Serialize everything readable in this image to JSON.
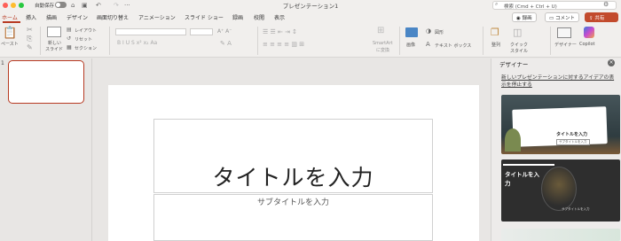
{
  "window": {
    "title": "プレゼンテーション1",
    "autosave_label": "自動保存",
    "search_placeholder": "検索 (Cmd + Ctrl + U)"
  },
  "tabs": [
    "ホーム",
    "挿入",
    "描画",
    "デザイン",
    "画面切り替え",
    "アニメーション",
    "スライド ショー",
    "録画",
    "校閲",
    "表示"
  ],
  "top_buttons": {
    "record": "録画",
    "comment": "コメント",
    "share": "共有"
  },
  "ribbon": {
    "paste": "ペースト",
    "new_slide_line1": "新しい",
    "new_slide_line2": "スライド",
    "layout": "レイアウト",
    "reset": "リセット",
    "section": "セクション",
    "smartart_line1": "SmartArt",
    "smartart_line2": "に変換",
    "picture": "画像",
    "shapes": "図形",
    "textbox": "テキスト ボックス",
    "arrange": "整列",
    "quickstyle_line1": "クイック",
    "quickstyle_line2": "スタイル",
    "designer": "デザイナー",
    "copilot": "Copilot"
  },
  "slides": {
    "thumb_number": "1"
  },
  "slide": {
    "title": "タイトルを入力",
    "subtitle": "サブタイトルを入力"
  },
  "designer": {
    "pane_title": "デザイナー",
    "link_text": "新しいプレゼンテーションに対するアイデアの表示を停止する",
    "card1_title": "タイトルを入力",
    "card1_sub": "サブタイトルを入力",
    "card2_title_line1": "タイトルを入",
    "card2_title_line2": "力",
    "card2_sub": "サブタイトルを入力"
  },
  "colors": {
    "accent": "#b73a22",
    "share": "#c24a2c",
    "traffic": [
      "#fe5f57",
      "#febc2e",
      "#28c840"
    ]
  }
}
